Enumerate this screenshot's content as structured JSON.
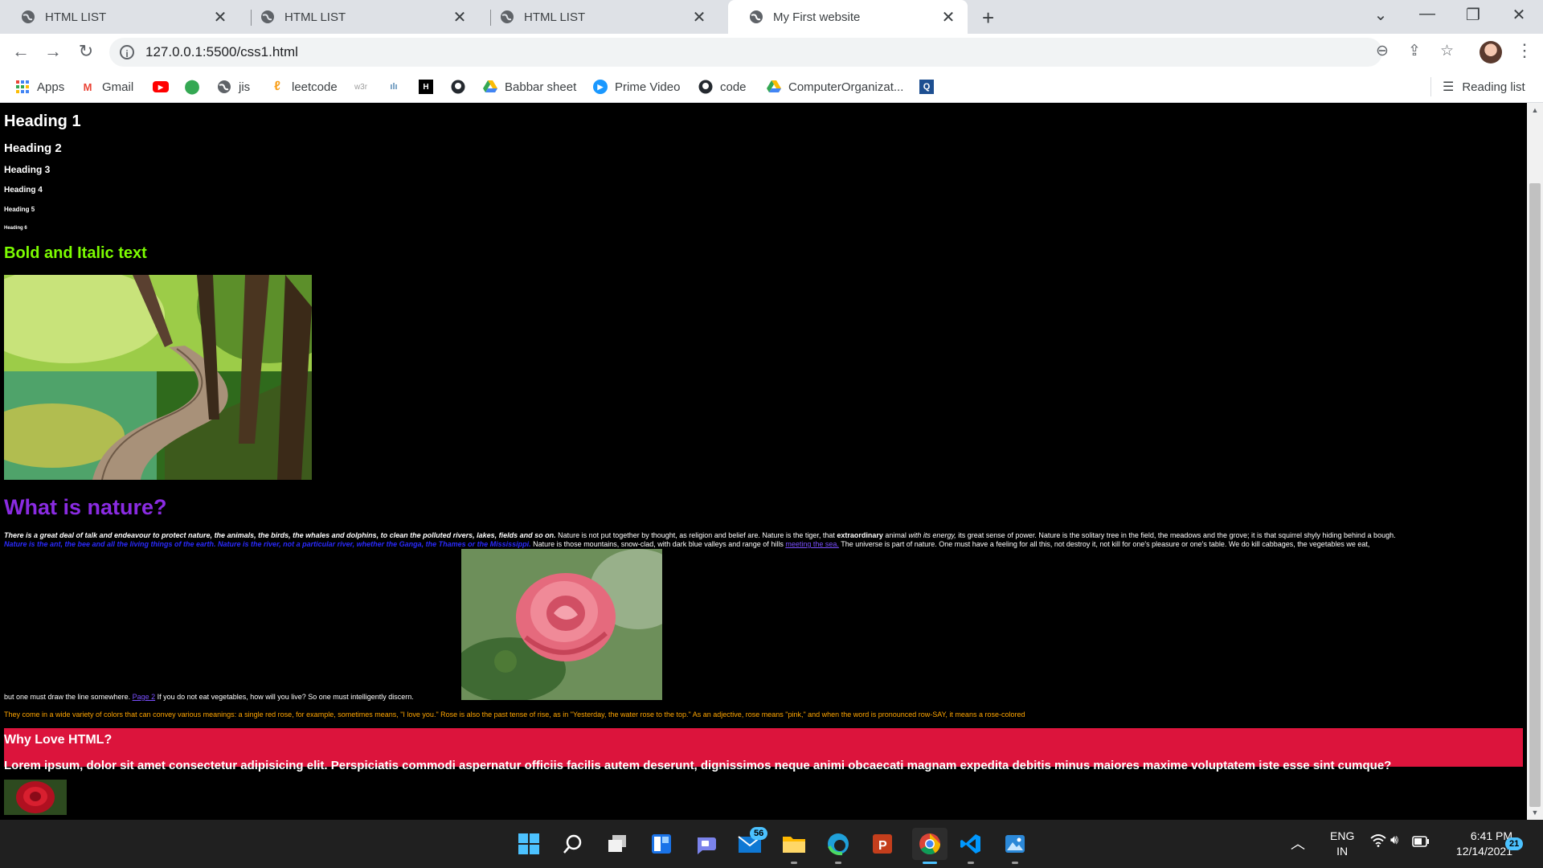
{
  "tabs": [
    {
      "title": "HTML LIST",
      "active": false
    },
    {
      "title": "HTML LIST",
      "active": false
    },
    {
      "title": "HTML LIST",
      "active": false
    },
    {
      "title": "My First website",
      "active": true
    }
  ],
  "address_bar": {
    "url": "127.0.0.1:5500/css1.html"
  },
  "bookmarks": [
    {
      "label": "Apps",
      "icon": "apps-grid-icon"
    },
    {
      "label": "Gmail",
      "icon": "gmail-icon"
    },
    {
      "label": "",
      "icon": "youtube-icon"
    },
    {
      "label": "",
      "icon": "maps-icon"
    },
    {
      "label": "jis",
      "icon": "globe-icon"
    },
    {
      "label": "leetcode",
      "icon": "leetcode-icon"
    },
    {
      "label": "",
      "icon": "w3schools-icon"
    },
    {
      "label": "",
      "icon": "codechef-icon"
    },
    {
      "label": "",
      "icon": "hackerrank-icon"
    },
    {
      "label": "",
      "icon": "github-icon"
    },
    {
      "label": "Babbar sheet",
      "icon": "google-drive-icon"
    },
    {
      "label": "Prime Video",
      "icon": "prime-video-icon"
    },
    {
      "label": "code",
      "icon": "github-icon"
    },
    {
      "label": "ComputerOrganizat...",
      "icon": "google-drive-icon"
    },
    {
      "label": "",
      "icon": "search-app-icon"
    }
  ],
  "reading_list": "Reading list",
  "content": {
    "headings": [
      "Heading 1",
      "Heading 2",
      "Heading 3",
      "Heading 4",
      "Heading 5",
      "Heading 6"
    ],
    "bold_italic": "Bold and Italic text",
    "nature_title": "What is nature?",
    "nature_italic": "There is a great deal of talk and endeavour to protect nature, the animals, the birds, the whales and dolphins, to clean the polluted rivers, lakes, fields and so on.",
    "nature_text1": " Nature is not put together by thought, as religion and belief are. Nature is the tiger, that ",
    "nature_strong": "extraordinary",
    "nature_text2": " animal ",
    "nature_em2": "with its energy,",
    "nature_text3": " its great sense of power. Nature is the solitary tree in the field, the meadows and the grove; it is that squirrel shyly hiding behind a bough.",
    "nature_blue": "Nature is the ant, the bee and all the living things of the earth. Nature is the river, not a particular river, whether the Ganga, the Thames or the Mississippi.",
    "nature_text4": " Nature is those mountains, snow-clad, with dark blue valleys and range of hills ",
    "nature_link": "meeting the sea.",
    "nature_text5": " The universe is part of nature. One must have a feeling for all this, not destroy it, not kill for one's pleasure or one's table. We do kill cabbages, the vegetables we eat,",
    "line_before_link": "but one must draw the line somewhere. ",
    "page2_link": "Page 2",
    "line_after_link": " If you do not eat vegetables, how will you live? So one must intelligently discern.",
    "rose_paragraph": "They come in a wide variety of colors that can convey various meanings: a single red rose, for example, sometimes means, \"I love you.\" Rose is also the past tense of rise, as in \"Yesterday, the water rose to the top.\" As an adjective, rose means \"pink,\" and when the word is pronounced row-SAY, it means a rose-colored",
    "why_title": "Why Love HTML?",
    "why_body": "Lorem ipsum, dolor sit amet consectetur adipisicing elit. Perspiciatis commodi aspernatur officiis facilis autem deserunt, dignissimos neque animi obcaecati magnam expedita debitis minus maiores maxime voluptatem iste esse sint cumque?"
  },
  "colors": {
    "bold_italic": "#7cfc00",
    "nature_title": "#8a2be2",
    "rose_paragraph": "#ffa500",
    "why_box": "#dc143c"
  },
  "taskbar": {
    "icons": [
      "windows-start-icon",
      "search-icon",
      "task-view-icon",
      "widgets-icon",
      "teams-chat-icon",
      "mail-icon",
      "file-explorer-icon",
      "edge-icon",
      "powerpoint-icon",
      "chrome-icon",
      "vscode-icon",
      "photos-icon"
    ],
    "mail_badge": "56",
    "language": "ENG",
    "region": "IN",
    "time": "6:41 PM",
    "date": "12/14/2021",
    "notification_count": "21"
  }
}
